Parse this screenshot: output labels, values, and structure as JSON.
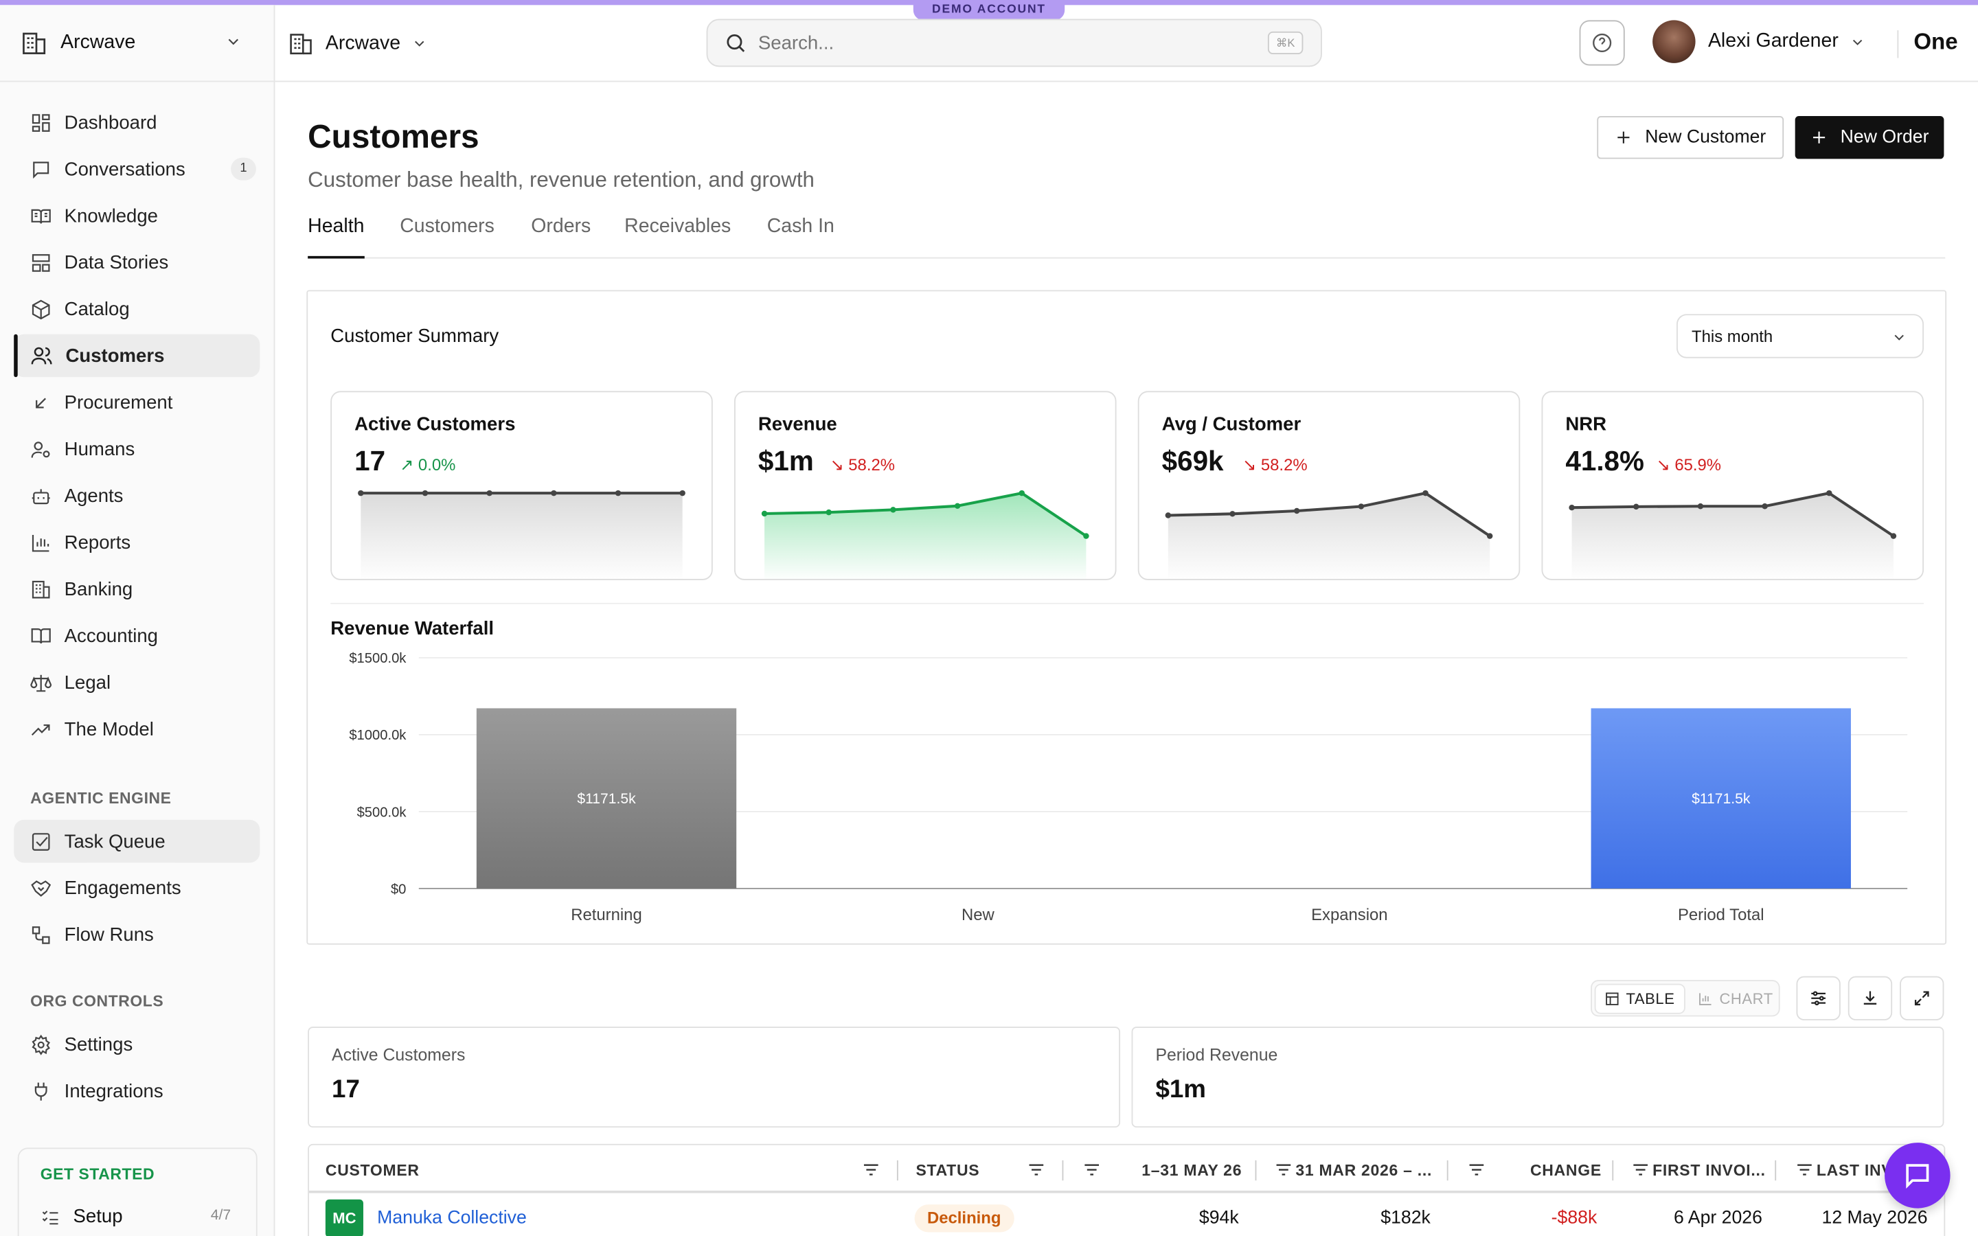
{
  "banner": {
    "demo_label": "DEMO ACCOUNT"
  },
  "sidebar": {
    "org_name": "Arcwave",
    "items": [
      {
        "label": "Dashboard",
        "icon": "dashboard-icon"
      },
      {
        "label": "Conversations",
        "icon": "chat-icon",
        "badge": "1"
      },
      {
        "label": "Knowledge",
        "icon": "book-open-icon"
      },
      {
        "label": "Data Stories",
        "icon": "layout-icon"
      },
      {
        "label": "Catalog",
        "icon": "box-icon"
      },
      {
        "label": "Customers",
        "icon": "users-icon",
        "active": true
      },
      {
        "label": "Procurement",
        "icon": "arrow-down-left-icon"
      },
      {
        "label": "Humans",
        "icon": "user-cog-icon"
      },
      {
        "label": "Agents",
        "icon": "bot-icon"
      },
      {
        "label": "Reports",
        "icon": "bar-chart-icon"
      },
      {
        "label": "Banking",
        "icon": "bank-icon"
      },
      {
        "label": "Accounting",
        "icon": "book-icon"
      },
      {
        "label": "Legal",
        "icon": "scale-icon"
      },
      {
        "label": "The Model",
        "icon": "trending-up-icon"
      }
    ],
    "agentic_section": "AGENTIC ENGINE",
    "agentic_items": [
      {
        "label": "Task Queue",
        "icon": "checkbox-icon"
      },
      {
        "label": "Engagements",
        "icon": "handshake-icon"
      },
      {
        "label": "Flow Runs",
        "icon": "workflow-icon"
      }
    ],
    "org_section": "ORG CONTROLS",
    "org_items": [
      {
        "label": "Settings",
        "icon": "gear-icon"
      },
      {
        "label": "Integrations",
        "icon": "plug-icon"
      }
    ],
    "get_started": {
      "title": "GET STARTED",
      "setup_label": "Setup",
      "progress": "4/7"
    }
  },
  "header": {
    "org_name": "Arcwave",
    "search_placeholder": "Search...",
    "search_shortcut": "⌘K",
    "user_name": "Alexi Gardener",
    "brand": "One"
  },
  "page": {
    "title": "Customers",
    "subtitle": "Customer base health, revenue retention, and growth",
    "new_customer_label": "New Customer",
    "new_order_label": "New Order",
    "tabs": [
      "Health",
      "Customers",
      "Orders",
      "Receivables",
      "Cash In"
    ],
    "active_tab": "Health"
  },
  "summary": {
    "title": "Customer Summary",
    "period": "This month",
    "kpis": [
      {
        "label": "Active Customers",
        "value": "17",
        "change": "0.0%",
        "direction": "up",
        "sparkline": [
          17,
          17,
          17,
          17,
          17,
          17
        ]
      },
      {
        "label": "Revenue",
        "value": "$1m",
        "change": "58.2%",
        "direction": "down",
        "sparkline": [
          0.68,
          0.7,
          0.74,
          0.8,
          1.0,
          0.33
        ]
      },
      {
        "label": "Avg / Customer",
        "value": "$69k",
        "change": "58.2%",
        "direction": "down",
        "sparkline": [
          0.7,
          0.72,
          0.76,
          0.82,
          1.0,
          0.42
        ]
      },
      {
        "label": "NRR",
        "value": "41.8%",
        "change": "65.9%",
        "direction": "down",
        "sparkline": [
          0.68,
          0.7,
          0.71,
          0.71,
          1.0,
          0.05
        ]
      }
    ]
  },
  "chart_data": {
    "type": "bar",
    "title": "Revenue Waterfall",
    "categories": [
      "Returning",
      "New",
      "Expansion",
      "Period Total"
    ],
    "values": [
      1171.5,
      0,
      0,
      1171.5
    ],
    "data_labels": [
      "$1171.5k",
      "",
      "",
      "$1171.5k"
    ],
    "ylim": [
      0,
      1500
    ],
    "yticks": [
      "$0",
      "$500.0k",
      "$1000.0k",
      "$1500.0k"
    ],
    "colors": [
      "#8a8a8a",
      "#8a8a8a",
      "#8a8a8a",
      "#4a7ff0"
    ],
    "grid": true
  },
  "view_toggle": {
    "table_label": "TABLE",
    "chart_label": "CHART",
    "active": "TABLE"
  },
  "stats": [
    {
      "label": "Active Customers",
      "value": "17"
    },
    {
      "label": "Period Revenue",
      "value": "$1m"
    }
  ],
  "table": {
    "columns": [
      "CUSTOMER",
      "STATUS",
      "1–31 MAY 26",
      "31 MAR 2026 – ...",
      "CHANGE",
      "FIRST INVOI...",
      "LAST INV..."
    ],
    "rows": [
      {
        "initials": "MC",
        "customer": "Manuka Collective",
        "status": "Declining",
        "current": "$94k",
        "previous": "$182k",
        "change": "-$88k",
        "first_invoice": "6 Apr 2026",
        "last_invoice": "12 May 2026"
      }
    ]
  },
  "colors": {
    "accent": "#b39bf2",
    "positive": "#17944a",
    "negative": "#d11f1f",
    "chat": "#7a2ff0",
    "bar_blue": "#4a7ff0"
  }
}
